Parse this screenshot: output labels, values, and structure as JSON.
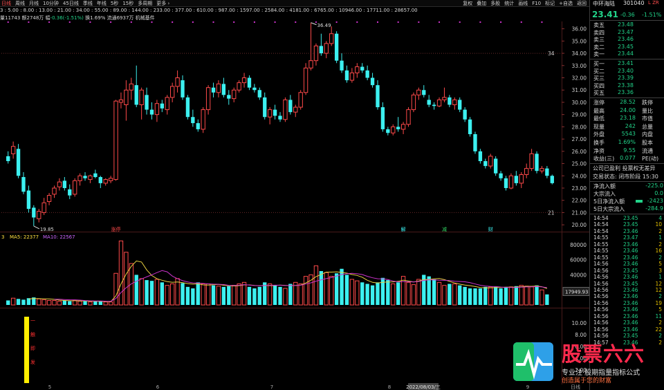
{
  "toolbar": {
    "periods": [
      "日线",
      "周线",
      "月线",
      "10分钟",
      "45日线",
      "季线",
      "年线",
      "5秒",
      "15秒",
      "多周期",
      "更多 ›"
    ],
    "tools": [
      "复权",
      "叠加",
      "多股",
      "统计",
      "画线",
      "F10",
      "标记",
      "+自选",
      "返回"
    ]
  },
  "info": {
    "ma_line": "3 : 5.00 : 8.00 : 13.00 : 21.00 : 34.00 : 55.00 : 89.00 : 144.00 : 233.00 : 377.00 : 610.00 : 987.00 : 1597.00 : 2584.00 : 4181.00 : 6765.00 : 10946.00 : 17711.00 : 28657.00",
    "detail_a": "量11743 额2748万 幅",
    "detail_b": "-0.36(-1.51%)",
    "detail_c": " 换1.69% 流通6937万 机械基件"
  },
  "price_axis": [
    "36.00",
    "35.00",
    "34.00",
    "33.00",
    "32.00",
    "31.00",
    "30.00",
    "29.00",
    "28.00",
    "27.00",
    "26.00",
    "25.00",
    "24.00",
    "23.00",
    "22.00",
    "21.00",
    "20.00"
  ],
  "ref_lines": {
    "upper": "34",
    "lower": "21"
  },
  "annotations": {
    "high": "36.49",
    "low": "19.85"
  },
  "markers": {
    "m1": "涨停",
    "m2": "解",
    "m3": "减",
    "m4": "财"
  },
  "volume": {
    "ma_label": "3",
    "ma5": "MA5: 22377",
    "ma10": "MA10: 22567",
    "axis": [
      "80000",
      "60000",
      "40000",
      "20000"
    ],
    "current": "17949.93"
  },
  "indicator": {
    "axis": [
      "10.00",
      "8.00",
      "6.00",
      "4.00",
      "2.00"
    ],
    "signal_text": "一\n触\n即\n发"
  },
  "xaxis": {
    "labels": [
      "5",
      "6",
      "7",
      "8",
      "9"
    ],
    "date": "2022/08/03/三",
    "period": "日线"
  },
  "chart_data": {
    "type": "candlestick",
    "ylim": [
      19.5,
      36.6
    ],
    "candles": [
      {
        "o": 25.6,
        "h": 26.0,
        "l": 25.0,
        "c": 25.2
      },
      {
        "o": 25.8,
        "h": 26.8,
        "l": 25.4,
        "c": 26.4
      },
      {
        "o": 26.2,
        "h": 26.6,
        "l": 23.8,
        "c": 24.0
      },
      {
        "o": 23.9,
        "h": 24.3,
        "l": 22.5,
        "c": 22.7
      },
      {
        "o": 22.8,
        "h": 23.2,
        "l": 21.0,
        "c": 21.3
      },
      {
        "o": 21.4,
        "h": 21.6,
        "l": 19.9,
        "c": 20.6
      },
      {
        "o": 20.5,
        "h": 21.3,
        "l": 20.2,
        "c": 21.1
      },
      {
        "o": 21.0,
        "h": 22.2,
        "l": 20.8,
        "c": 21.8
      },
      {
        "o": 21.9,
        "h": 22.6,
        "l": 21.6,
        "c": 22.4
      },
      {
        "o": 22.5,
        "h": 23.2,
        "l": 22.2,
        "c": 23.0
      },
      {
        "o": 23.1,
        "h": 23.8,
        "l": 22.8,
        "c": 23.5
      },
      {
        "o": 23.6,
        "h": 23.9,
        "l": 22.8,
        "c": 23.0
      },
      {
        "o": 22.9,
        "h": 23.3,
        "l": 22.1,
        "c": 22.4
      },
      {
        "o": 22.5,
        "h": 23.8,
        "l": 22.3,
        "c": 23.6
      },
      {
        "o": 23.6,
        "h": 24.2,
        "l": 23.2,
        "c": 24.0
      },
      {
        "o": 24.0,
        "h": 24.3,
        "l": 23.6,
        "c": 23.8
      },
      {
        "o": 23.7,
        "h": 24.1,
        "l": 23.4,
        "c": 24.0
      },
      {
        "o": 24.2,
        "h": 24.5,
        "l": 23.8,
        "c": 23.9
      },
      {
        "o": 23.9,
        "h": 24.0,
        "l": 23.0,
        "c": 23.4
      },
      {
        "o": 23.4,
        "h": 23.8,
        "l": 23.2,
        "c": 23.7
      },
      {
        "o": 23.6,
        "h": 24.0,
        "l": 23.4,
        "c": 23.8
      },
      {
        "o": 23.7,
        "h": 30.2,
        "l": 23.6,
        "c": 30.1
      },
      {
        "o": 30.0,
        "h": 30.8,
        "l": 29.5,
        "c": 30.2
      },
      {
        "o": 29.8,
        "h": 31.8,
        "l": 28.5,
        "c": 31.0
      },
      {
        "o": 31.0,
        "h": 32.0,
        "l": 30.2,
        "c": 31.5
      },
      {
        "o": 31.4,
        "h": 33.0,
        "l": 29.6,
        "c": 29.8
      },
      {
        "o": 29.8,
        "h": 31.2,
        "l": 28.6,
        "c": 31.0
      },
      {
        "o": 30.6,
        "h": 31.2,
        "l": 29.0,
        "c": 29.4
      },
      {
        "o": 29.4,
        "h": 30.0,
        "l": 28.6,
        "c": 29.0
      },
      {
        "o": 29.0,
        "h": 30.2,
        "l": 28.4,
        "c": 29.9
      },
      {
        "o": 29.9,
        "h": 30.2,
        "l": 29.2,
        "c": 29.5
      },
      {
        "o": 29.4,
        "h": 30.6,
        "l": 29.0,
        "c": 30.4
      },
      {
        "o": 30.4,
        "h": 31.6,
        "l": 30.0,
        "c": 31.3
      },
      {
        "o": 31.3,
        "h": 32.6,
        "l": 30.8,
        "c": 32.0
      },
      {
        "o": 31.8,
        "h": 32.2,
        "l": 30.2,
        "c": 30.4
      },
      {
        "o": 30.4,
        "h": 30.6,
        "l": 28.6,
        "c": 28.8
      },
      {
        "o": 28.8,
        "h": 29.4,
        "l": 28.0,
        "c": 28.3
      },
      {
        "o": 28.3,
        "h": 28.6,
        "l": 27.6,
        "c": 27.8
      },
      {
        "o": 27.8,
        "h": 29.6,
        "l": 27.5,
        "c": 29.4
      },
      {
        "o": 29.4,
        "h": 31.4,
        "l": 29.0,
        "c": 31.2
      },
      {
        "o": 31.2,
        "h": 31.6,
        "l": 30.4,
        "c": 30.8
      },
      {
        "o": 30.8,
        "h": 31.8,
        "l": 30.4,
        "c": 31.5
      },
      {
        "o": 31.5,
        "h": 32.0,
        "l": 30.4,
        "c": 30.6
      },
      {
        "o": 30.6,
        "h": 31.0,
        "l": 29.8,
        "c": 30.3
      },
      {
        "o": 30.3,
        "h": 31.2,
        "l": 30.0,
        "c": 31.0
      },
      {
        "o": 31.0,
        "h": 31.8,
        "l": 30.8,
        "c": 31.6
      },
      {
        "o": 31.6,
        "h": 32.4,
        "l": 31.2,
        "c": 32.0
      },
      {
        "o": 32.0,
        "h": 32.2,
        "l": 31.0,
        "c": 31.2
      },
      {
        "o": 31.2,
        "h": 31.5,
        "l": 30.8,
        "c": 31.0
      },
      {
        "o": 31.0,
        "h": 31.2,
        "l": 30.2,
        "c": 30.4
      },
      {
        "o": 30.4,
        "h": 30.8,
        "l": 28.6,
        "c": 28.8
      },
      {
        "o": 28.8,
        "h": 29.6,
        "l": 28.2,
        "c": 29.4
      },
      {
        "o": 29.4,
        "h": 29.8,
        "l": 28.6,
        "c": 28.9
      },
      {
        "o": 28.9,
        "h": 29.2,
        "l": 28.4,
        "c": 28.6
      },
      {
        "o": 28.6,
        "h": 30.4,
        "l": 28.4,
        "c": 30.2
      },
      {
        "o": 30.2,
        "h": 30.6,
        "l": 29.0,
        "c": 29.2
      },
      {
        "o": 29.2,
        "h": 29.8,
        "l": 28.8,
        "c": 29.6
      },
      {
        "o": 29.6,
        "h": 31.0,
        "l": 29.4,
        "c": 30.8
      },
      {
        "o": 30.8,
        "h": 33.2,
        "l": 30.6,
        "c": 32.8
      },
      {
        "o": 32.8,
        "h": 36.5,
        "l": 32.6,
        "c": 33.4
      },
      {
        "o": 33.4,
        "h": 34.8,
        "l": 33.0,
        "c": 34.6
      },
      {
        "o": 34.6,
        "h": 35.6,
        "l": 33.8,
        "c": 34.0
      },
      {
        "o": 34.0,
        "h": 35.0,
        "l": 33.6,
        "c": 34.8
      },
      {
        "o": 34.8,
        "h": 36.2,
        "l": 34.6,
        "c": 35.6
      },
      {
        "o": 35.6,
        "h": 35.8,
        "l": 33.2,
        "c": 33.4
      },
      {
        "o": 33.4,
        "h": 34.0,
        "l": 32.4,
        "c": 32.6
      },
      {
        "o": 32.6,
        "h": 33.0,
        "l": 31.6,
        "c": 31.8
      },
      {
        "o": 31.8,
        "h": 32.8,
        "l": 31.6,
        "c": 32.4
      },
      {
        "o": 32.4,
        "h": 33.2,
        "l": 32.0,
        "c": 32.9
      },
      {
        "o": 32.9,
        "h": 33.2,
        "l": 32.4,
        "c": 32.6
      },
      {
        "o": 32.6,
        "h": 33.0,
        "l": 31.8,
        "c": 32.0
      },
      {
        "o": 32.0,
        "h": 32.4,
        "l": 31.2,
        "c": 31.4
      },
      {
        "o": 31.4,
        "h": 31.8,
        "l": 29.4,
        "c": 29.6
      },
      {
        "o": 29.6,
        "h": 30.0,
        "l": 27.6,
        "c": 27.8
      },
      {
        "o": 27.8,
        "h": 28.0,
        "l": 27.3,
        "c": 27.5
      },
      {
        "o": 27.5,
        "h": 28.2,
        "l": 27.3,
        "c": 28.0
      },
      {
        "o": 28.0,
        "h": 28.8,
        "l": 27.6,
        "c": 27.8
      },
      {
        "o": 27.8,
        "h": 28.4,
        "l": 27.4,
        "c": 28.2
      },
      {
        "o": 28.2,
        "h": 29.6,
        "l": 28.0,
        "c": 29.4
      },
      {
        "o": 29.4,
        "h": 30.8,
        "l": 29.2,
        "c": 30.6
      },
      {
        "o": 30.6,
        "h": 31.2,
        "l": 30.2,
        "c": 31.0
      },
      {
        "o": 31.0,
        "h": 31.4,
        "l": 30.4,
        "c": 30.6
      },
      {
        "o": 30.2,
        "h": 30.6,
        "l": 29.6,
        "c": 29.8
      },
      {
        "o": 29.8,
        "h": 30.0,
        "l": 29.4,
        "c": 29.7
      },
      {
        "o": 29.7,
        "h": 30.4,
        "l": 29.6,
        "c": 30.2
      },
      {
        "o": 30.2,
        "h": 31.2,
        "l": 30.0,
        "c": 30.4
      },
      {
        "o": 30.4,
        "h": 30.6,
        "l": 29.6,
        "c": 29.8
      },
      {
        "o": 29.8,
        "h": 30.4,
        "l": 29.4,
        "c": 30.2
      },
      {
        "o": 30.2,
        "h": 30.4,
        "l": 29.2,
        "c": 29.4
      },
      {
        "o": 29.4,
        "h": 29.6,
        "l": 28.4,
        "c": 28.6
      },
      {
        "o": 28.6,
        "h": 28.8,
        "l": 27.2,
        "c": 27.4
      },
      {
        "o": 27.4,
        "h": 27.6,
        "l": 25.8,
        "c": 26.0
      },
      {
        "o": 26.0,
        "h": 26.2,
        "l": 25.0,
        "c": 25.2
      },
      {
        "o": 25.2,
        "h": 25.4,
        "l": 24.6,
        "c": 24.8
      },
      {
        "o": 24.8,
        "h": 25.8,
        "l": 24.6,
        "c": 25.6
      },
      {
        "o": 25.4,
        "h": 25.6,
        "l": 24.0,
        "c": 24.2
      },
      {
        "o": 24.2,
        "h": 24.4,
        "l": 23.6,
        "c": 23.8
      },
      {
        "o": 23.8,
        "h": 24.0,
        "l": 22.8,
        "c": 23.0
      },
      {
        "o": 23.0,
        "h": 24.2,
        "l": 22.9,
        "c": 24.0
      },
      {
        "o": 24.0,
        "h": 24.4,
        "l": 23.2,
        "c": 23.4
      },
      {
        "o": 23.4,
        "h": 24.3,
        "l": 23.0,
        "c": 24.1
      },
      {
        "o": 24.1,
        "h": 25.0,
        "l": 23.8,
        "c": 24.6
      },
      {
        "o": 24.6,
        "h": 26.2,
        "l": 24.4,
        "c": 25.8
      },
      {
        "o": 25.8,
        "h": 26.0,
        "l": 24.2,
        "c": 24.4
      },
      {
        "o": 24.4,
        "h": 24.8,
        "l": 24.2,
        "c": 24.6
      },
      {
        "o": 24.6,
        "h": 24.8,
        "l": 23.8,
        "c": 24.0
      },
      {
        "o": 24.0,
        "h": 24.1,
        "l": 23.3,
        "c": 23.4
      }
    ],
    "volumes": [
      6,
      9,
      8,
      7,
      9,
      10,
      8,
      7,
      6,
      6,
      5,
      6,
      5,
      6,
      5,
      5,
      4,
      5,
      5,
      4,
      4,
      42,
      85,
      70,
      55,
      40,
      35,
      33,
      32,
      34,
      30,
      26,
      28,
      35,
      29,
      24,
      22,
      30,
      28,
      28,
      26,
      25,
      24,
      25,
      26,
      28,
      30,
      24,
      22,
      24,
      30,
      28,
      26,
      24,
      22,
      28,
      30,
      28,
      38,
      40,
      52,
      45,
      43,
      38,
      42,
      48,
      40,
      34,
      32,
      30,
      28,
      26,
      30,
      36,
      33,
      28,
      30,
      38,
      30,
      27,
      34,
      40,
      38,
      34,
      30,
      26,
      28,
      28,
      26,
      24,
      22,
      22,
      22,
      24,
      24,
      24,
      22,
      24,
      24,
      25,
      26,
      25,
      24,
      26,
      20,
      14
    ]
  },
  "panel": {
    "name": "中环海陆",
    "code": "301040",
    "tag": "L ZR",
    "price": "23.41",
    "change": "-0.36",
    "change_pct": "-1.51%",
    "asks": [
      {
        "label": "卖五",
        "price": "23.48"
      },
      {
        "label": "卖四",
        "price": "23.47"
      },
      {
        "label": "卖三",
        "price": "23.46"
      },
      {
        "label": "卖二",
        "price": "23.45"
      },
      {
        "label": "卖一",
        "price": "23.44"
      }
    ],
    "bids": [
      {
        "label": "买一",
        "price": "23.41"
      },
      {
        "label": "买二",
        "price": "23.40"
      },
      {
        "label": "买三",
        "price": "23.39"
      },
      {
        "label": "买四",
        "price": "23.38"
      },
      {
        "label": "买五",
        "price": "23.36"
      }
    ],
    "stats": [
      {
        "k1": "涨停",
        "v1": "28.52",
        "c1": "r",
        "k2": "跌停"
      },
      {
        "k1": "最高",
        "v1": "24.00",
        "c1": "r",
        "k2": "量比"
      },
      {
        "k1": "最低",
        "v1": "23.18",
        "c1": "g",
        "k2": "市值"
      },
      {
        "k1": "现量",
        "v1": "242",
        "c1": "w",
        "k2": "总量"
      },
      {
        "k1": "外盘",
        "v1": "5543",
        "c1": "r",
        "k2": "内盘"
      },
      {
        "k1": "换手",
        "v1": "1.69%",
        "c1": "w",
        "k2": "股本"
      },
      {
        "k1": "净资",
        "v1": "9.55",
        "c1": "w",
        "k2": "流通"
      },
      {
        "k1": "收益(三)",
        "v1": "0.077",
        "c1": "w",
        "k2": "PE(动)"
      }
    ],
    "notes": [
      "公司已盈利 投票权无差异",
      "交易状态: 闭市阶段 15:30"
    ],
    "flows": [
      {
        "k": "净流入额",
        "v": "-225.0"
      },
      {
        "k": "大宗流入",
        "v": "0.0"
      },
      {
        "k": "5日净流入额",
        "v": "-2423"
      },
      {
        "k": "5日大宗流入",
        "v": "-284.9"
      }
    ],
    "ticks": [
      {
        "t": "14:54",
        "p": "23.45",
        "v": "4"
      },
      {
        "t": "14:54",
        "p": "23.45",
        "v": "10"
      },
      {
        "t": "14:54",
        "p": "23.46",
        "v": "2"
      },
      {
        "t": "14:55",
        "p": "23.47",
        "v": "1"
      },
      {
        "t": "14:55",
        "p": "23.46",
        "v": "2"
      },
      {
        "t": "14:55",
        "p": "23.46",
        "v": "16"
      },
      {
        "t": "14:55",
        "p": "23.46",
        "v": "2"
      },
      {
        "t": "14:56",
        "p": "23.46",
        "v": "5"
      },
      {
        "t": "14:56",
        "p": "23.45",
        "v": "3"
      },
      {
        "t": "14:56",
        "p": "23.46",
        "v": "1"
      },
      {
        "t": "14:56",
        "p": "23.45",
        "v": "12"
      },
      {
        "t": "14:56",
        "p": "23.46",
        "v": "12"
      },
      {
        "t": "14:56",
        "p": "23.46",
        "v": "2"
      },
      {
        "t": "14:56",
        "p": "23.46",
        "v": "19"
      },
      {
        "t": "14:56",
        "p": "23.46",
        "v": "5"
      },
      {
        "t": "14:56",
        "p": "23.46",
        "v": "11"
      },
      {
        "t": "14:56",
        "p": "23.46",
        "v": "2"
      },
      {
        "t": "14:56",
        "p": "23.46",
        "v": "22"
      },
      {
        "t": "14:56",
        "p": "23.45",
        "v": "2"
      },
      {
        "t": "14:57",
        "p": "23.46",
        "v": "2"
      }
    ]
  },
  "watermark": {
    "title": "股票六六",
    "line1": "专业注·股期指量指标公式",
    "line2": "创造属于您的财富"
  }
}
